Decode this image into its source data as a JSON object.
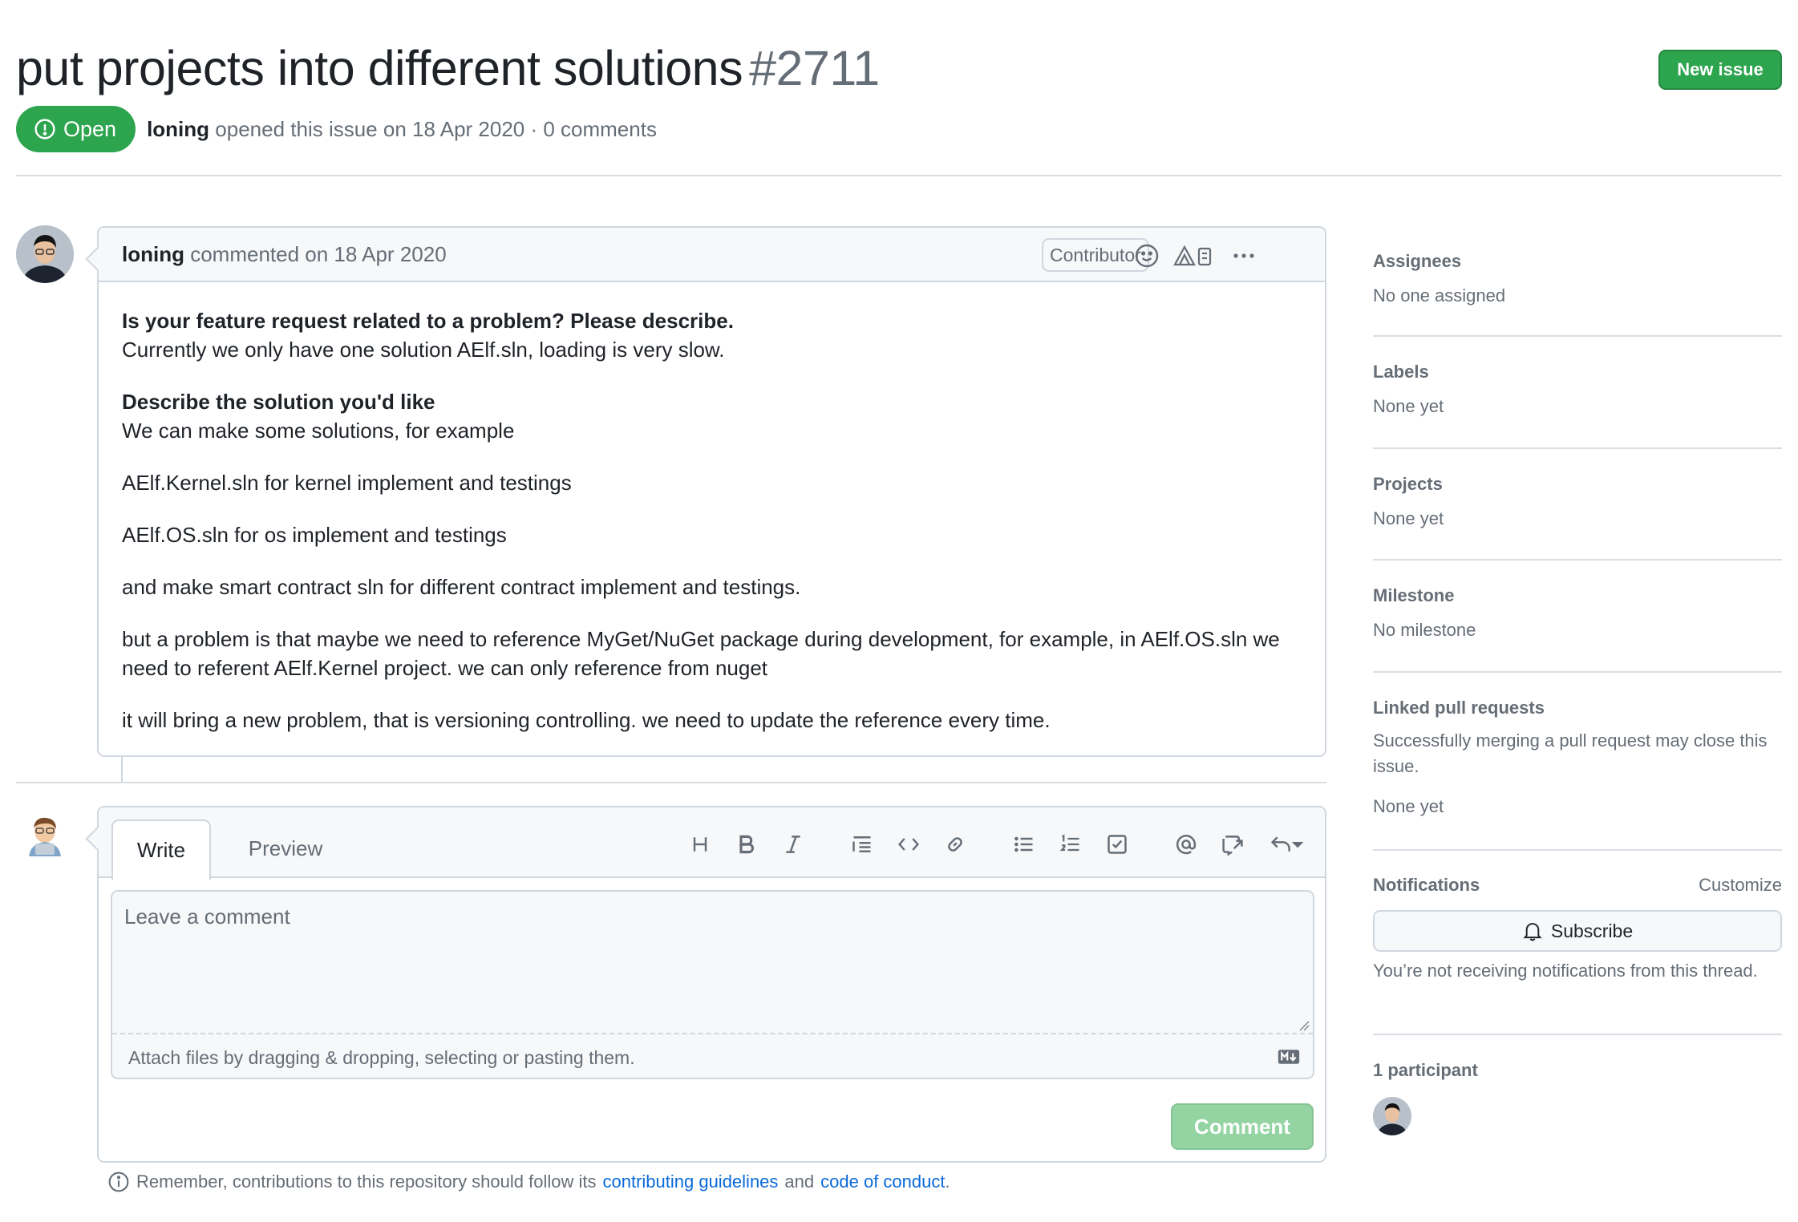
{
  "issue": {
    "title": "put projects into different solutions",
    "number": "#2711",
    "new_issue_label": "New issue",
    "state": "Open",
    "author": "loning",
    "meta": "opened this issue on 18 Apr 2020 · 0 comments"
  },
  "comment": {
    "author": "loning",
    "meta": "commented on 18 Apr 2020",
    "badge": "Contributor",
    "body": {
      "h1": "Is your feature request related to a problem? Please describe.",
      "p1": "Currently we only have one solution AElf.sln, loading is very slow.",
      "h2": "Describe the solution you'd like",
      "p2": "We can make some solutions, for example",
      "p3": "AElf.Kernel.sln for kernel implement and testings",
      "p4": "AElf.OS.sln for os implement and testings",
      "p5": "and make smart contract sln for different contract implement and testings.",
      "p6": "but a problem is that maybe we need to reference MyGet/NuGet package during development, for example, in AElf.OS.sln we need to referent AElf.Kernel project. we can only reference from nuget",
      "p7": "it will bring a new problem, that is versioning controlling. we need to update the reference every time."
    }
  },
  "form": {
    "tab_write": "Write",
    "tab_preview": "Preview",
    "placeholder": "Leave a comment",
    "attach_hint": "Attach files by dragging & dropping, selecting or pasting them.",
    "submit_label": "Comment"
  },
  "footer": {
    "prefix": "Remember, contributions to this repository should follow its",
    "link1": "contributing guidelines",
    "and": "and",
    "link2": "code of conduct",
    "suffix": "."
  },
  "sidebar": {
    "assignees": {
      "title": "Assignees",
      "value": "No one assigned"
    },
    "labels": {
      "title": "Labels",
      "value": "None yet"
    },
    "projects": {
      "title": "Projects",
      "value": "None yet"
    },
    "milestone": {
      "title": "Milestone",
      "value": "No milestone"
    },
    "linked_prs": {
      "title": "Linked pull requests",
      "desc": "Successfully merging a pull request may close this issue.",
      "value": "None yet"
    },
    "notifications": {
      "title": "Notifications",
      "customize": "Customize",
      "subscribe": "Subscribe",
      "desc": "You’re not receiving notifications from this thread."
    },
    "participants": {
      "title": "1 participant"
    }
  },
  "colors": {
    "primary": "#2da44e",
    "link": "#0969da",
    "muted": "#656d76",
    "border": "#d0d7de"
  },
  "icons": [
    "issue-opened-icon",
    "smiley-icon",
    "ai-icon",
    "kebab-icon",
    "heading-icon",
    "bold-icon",
    "italic-icon",
    "quote-icon",
    "code-icon",
    "link-icon",
    "unordered-list-icon",
    "ordered-list-icon",
    "tasklist-icon",
    "mention-icon",
    "cross-reference-icon",
    "reply-icon",
    "markdown-icon",
    "info-icon",
    "bell-icon"
  ]
}
